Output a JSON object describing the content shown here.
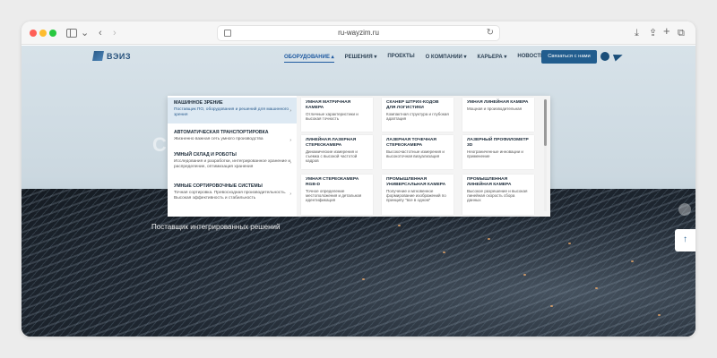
{
  "browser": {
    "url": "ru-wayzim.ru"
  },
  "site": {
    "logo_text": "ВЭИЗ",
    "nav": [
      {
        "label": "ОБОРУДОВАНИЕ",
        "arrow": "▴"
      },
      {
        "label": "РЕШЕНИЯ",
        "arrow": "▾"
      },
      {
        "label": "ПРОЕКТЫ",
        "arrow": ""
      },
      {
        "label": "О КОМПАНИИ",
        "arrow": "▾"
      },
      {
        "label": "КАРЬЕРА",
        "arrow": "▾"
      },
      {
        "label": "НОВОСТИ",
        "arrow": ""
      }
    ],
    "contact_label": "Связаться с нами",
    "hero_tagline": "Поставщик интегрированных решений",
    "hero_heading_fragment": "С",
    "scroll_top_icon": "↑"
  },
  "menu": {
    "categories": [
      {
        "title": "МАШИННОЕ ЗРЕНИЕ",
        "subtitle": "Поставщик ПО, оборудования и решений для машинного зрения",
        "active": true
      },
      {
        "title": "АВТОМАТИЧЕСКАЯ ТРАНСПОРТИРОВКА",
        "subtitle": "Жизненно важная сеть умного производства",
        "active": false
      },
      {
        "title": "УМНЫЙ СКЛАД И РОБОТЫ",
        "subtitle": "Исследования и разработки, интегрированное хранение и распределение, оптимизация хранения",
        "active": false
      },
      {
        "title": "УМНЫЕ СОРТИРОВОЧНЫЕ СИСТЕМЫ",
        "subtitle": "Точная сортировка. Превосходная производительность. Высокая эффективность и стабильность",
        "active": false
      }
    ],
    "products": [
      {
        "title": "УМНАЯ МАТРИЧНАЯ КАМЕРА",
        "subtitle": "Отличные характеристики и высокая точность"
      },
      {
        "title": "СКАНЕР ШТРИХ-КОДОВ ДЛЯ ЛОГИСТИКИ",
        "subtitle": "Компактная структура и глубокая адаптация"
      },
      {
        "title": "УМНАЯ ЛИНЕЙНАЯ КАМЕРА",
        "subtitle": "Мощная и производительная"
      },
      {
        "title": "ЛИНЕЙНАЯ ЛАЗЕРНАЯ СТЕРЕОКАМЕРА",
        "subtitle": "Динамические измерения и съемка с высокой частотой кадров"
      },
      {
        "title": "ЛАЗЕРНАЯ ТОЧЕЧНАЯ СТЕРЕОКАМЕРА",
        "subtitle": "Высокочастотные измерения и высокоточная визуализация"
      },
      {
        "title": "ЛАЗЕРНЫЙ ПРОФИЛОМЕТР 3D",
        "subtitle": "Неограниченные инновации и применение"
      },
      {
        "title": "УМНАЯ СТЕРЕОКАМЕРА RGB-D",
        "subtitle": "Точное определение местоположения и детальная идентификация"
      },
      {
        "title": "ПРОМЫШЛЕННАЯ УНИВЕРСАЛЬНАЯ КАМЕРА",
        "subtitle": "Получение и мгновенное формирование изображений по принципу \"все в одном\""
      },
      {
        "title": "ПРОМЫШЛЕННАЯ ЛИНЕЙНАЯ КАМЕРА",
        "subtitle": "Высокое разрешение и высокая линейная скорость сбора данных"
      }
    ]
  },
  "slider": {
    "count": 4,
    "active_index": 0
  },
  "colors": {
    "accent": "#225d8e",
    "active_nav": "#1f5aa0",
    "active_category_bg": "#dde9f3"
  }
}
